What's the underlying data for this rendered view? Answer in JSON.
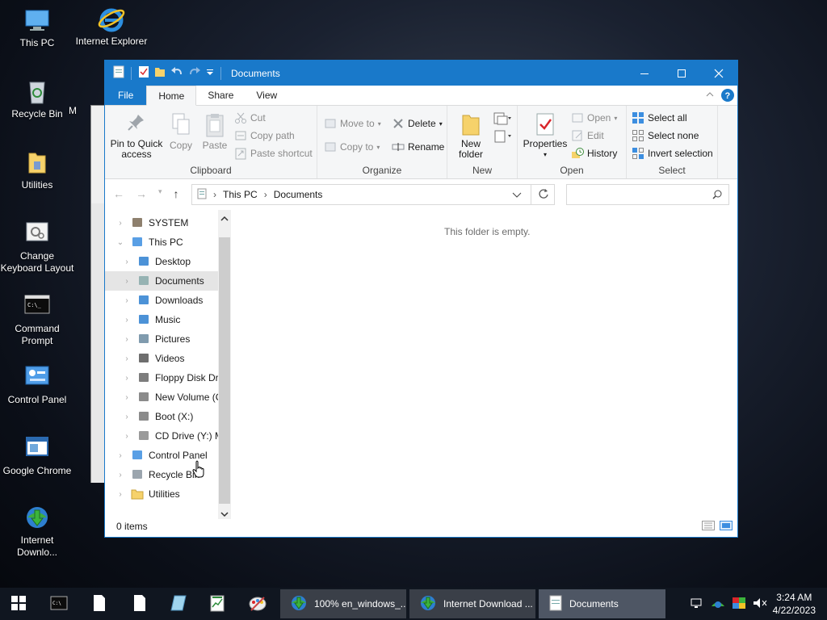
{
  "desktop": {
    "icons": [
      {
        "label": "This PC",
        "icon": "this-pc-icon"
      },
      {
        "label": "Internet Explorer",
        "icon": "ie-icon"
      },
      {
        "label": "Recycle Bin",
        "icon": "recycle-bin-icon"
      },
      {
        "label": "Utilities",
        "icon": "folder-icon"
      },
      {
        "label": "Change Keyboard Layout",
        "icon": "keyboard-settings-icon"
      },
      {
        "label": "Command Prompt",
        "icon": "cmd-icon"
      },
      {
        "label": "Control Panel",
        "icon": "control-panel-icon"
      },
      {
        "label": "Google Chrome",
        "icon": "chrome-window-icon"
      },
      {
        "label": "Internet Downlo...",
        "icon": "idm-icon"
      }
    ],
    "partial_label": "M"
  },
  "explorer": {
    "title": "Documents",
    "tabs": {
      "file": "File",
      "home": "Home",
      "share": "Share",
      "view": "View"
    },
    "ribbon": {
      "clipboard": {
        "name": "Clipboard",
        "pin": "Pin to Quick access",
        "copy": "Copy",
        "paste": "Paste",
        "cut": "Cut",
        "copy_path": "Copy path",
        "paste_shortcut": "Paste shortcut"
      },
      "organize": {
        "name": "Organize",
        "move_to": "Move to",
        "copy_to": "Copy to",
        "delete": "Delete",
        "rename": "Rename"
      },
      "new": {
        "name": "New",
        "new_folder": "New folder"
      },
      "open": {
        "name": "Open",
        "properties": "Properties",
        "open": "Open",
        "edit": "Edit",
        "history": "History"
      },
      "select": {
        "name": "Select",
        "select_all": "Select all",
        "select_none": "Select none",
        "invert": "Invert selection"
      }
    },
    "address": {
      "crumbs": [
        "This PC",
        "Documents"
      ]
    },
    "nav_pane": [
      {
        "label": "SYSTEM",
        "level": 0,
        "icon": "user-icon"
      },
      {
        "label": "This PC",
        "level": 0,
        "icon": "this-pc-icon",
        "expanded": true
      },
      {
        "label": "Desktop",
        "level": 1,
        "icon": "desktop-icon"
      },
      {
        "label": "Documents",
        "level": 1,
        "icon": "documents-icon",
        "selected": true
      },
      {
        "label": "Downloads",
        "level": 1,
        "icon": "downloads-icon"
      },
      {
        "label": "Music",
        "level": 1,
        "icon": "music-icon"
      },
      {
        "label": "Pictures",
        "level": 1,
        "icon": "pictures-icon"
      },
      {
        "label": "Videos",
        "level": 1,
        "icon": "videos-icon"
      },
      {
        "label": "Floppy Disk Dri",
        "level": 1,
        "icon": "floppy-icon"
      },
      {
        "label": "New Volume (C",
        "level": 1,
        "icon": "drive-icon"
      },
      {
        "label": "Boot (X:)",
        "level": 1,
        "icon": "drive-icon"
      },
      {
        "label": "CD Drive (Y:) M",
        "level": 1,
        "icon": "cd-drive-icon"
      },
      {
        "label": "Control Panel",
        "level": 0,
        "icon": "control-panel-icon"
      },
      {
        "label": "Recycle Bin",
        "level": 0,
        "icon": "recycle-bin-icon"
      },
      {
        "label": "Utilities",
        "level": 0,
        "icon": "folder-icon"
      }
    ],
    "empty_message": "This folder is empty.",
    "status": "0 items"
  },
  "taskbar": {
    "tasks": [
      {
        "label": "100% en_windows_...",
        "icon": "idm-icon"
      },
      {
        "label": "Internet Download ...",
        "icon": "idm-icon"
      },
      {
        "label": "Documents",
        "icon": "documents-icon"
      }
    ],
    "clock": {
      "time": "3:24 AM",
      "date": "4/22/2023"
    }
  }
}
